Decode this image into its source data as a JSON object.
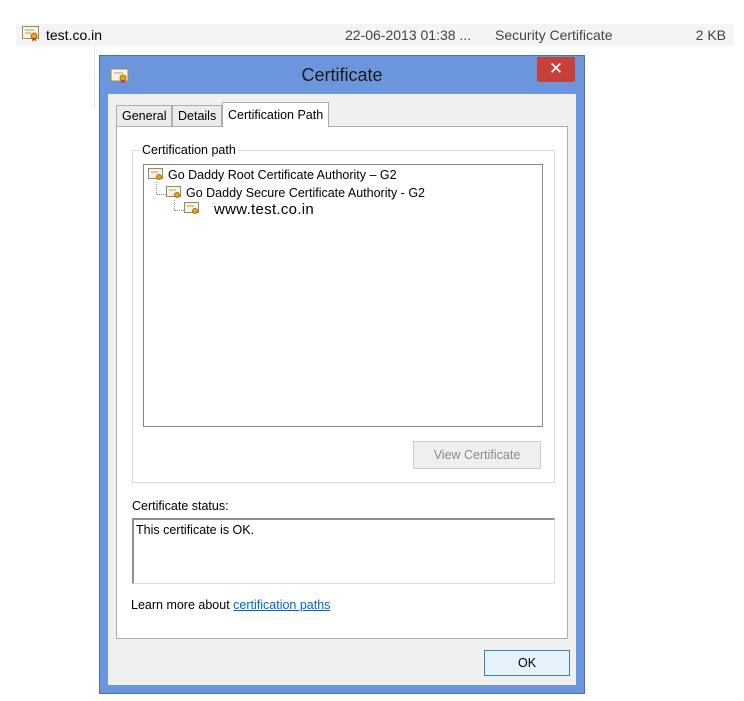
{
  "file_row": {
    "name": "test.co.in",
    "date": "22-06-2013 01:38 ...",
    "type": "Security Certificate",
    "size": "2 KB",
    "icon": "certificate-icon"
  },
  "dialog": {
    "title": "Certificate",
    "close_label": "✕",
    "tabs": [
      {
        "label": "General",
        "active": false
      },
      {
        "label": "Details",
        "active": false
      },
      {
        "label": "Certification Path",
        "active": true
      }
    ],
    "cert_path": {
      "group_label": "Certification path",
      "nodes": [
        {
          "label": "Go Daddy Root Certificate Authority – G2",
          "icon": "certificate-icon"
        },
        {
          "label": "Go Daddy Secure Certificate Authority - G2",
          "icon": "certificate-icon"
        },
        {
          "label": "www.test.co.in",
          "icon": "certificate-icon"
        }
      ],
      "view_button": "View Certificate",
      "view_button_enabled": false
    },
    "status": {
      "label": "Certificate status:",
      "text": "This certificate is OK."
    },
    "learn_more": {
      "prefix": "Learn more about ",
      "link": "certification paths"
    },
    "ok_button": "OK"
  },
  "colors": {
    "window_frame": "#6b95dc",
    "close_button": "#c7403a",
    "link": "#0066cc"
  }
}
